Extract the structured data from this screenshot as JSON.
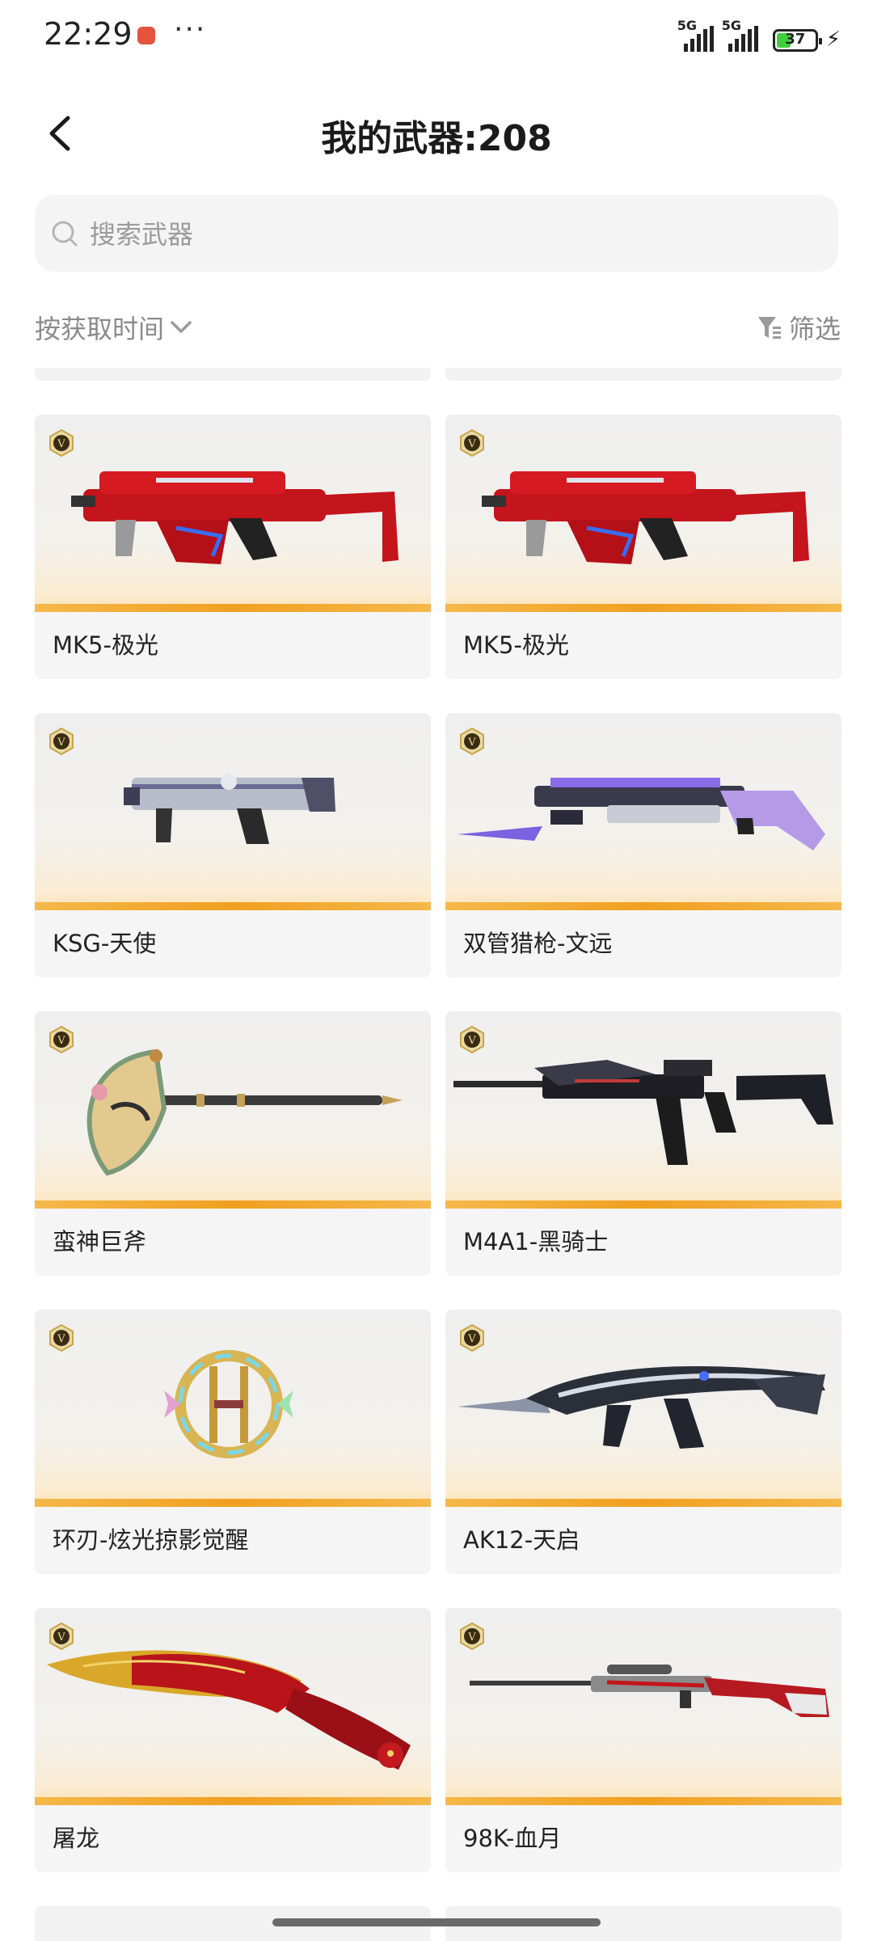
{
  "status_bar": {
    "time": "22:29",
    "more": "···",
    "signal1_label": "5G",
    "signal2_label": "5G",
    "battery": "37",
    "battery_level": 0.37
  },
  "header": {
    "title": "我的武器:208",
    "back_icon": "back-arrow-icon"
  },
  "search": {
    "placeholder": "搜索武器",
    "value": ""
  },
  "toolbar": {
    "sort_label": "按获取时间",
    "filter_label": "筛选"
  },
  "colors": {
    "accent_stripe": "#f0a020",
    "badge": "#c7a54a"
  },
  "weapons": [
    {
      "title": "MK5-极光",
      "icon": "smg-red-icon"
    },
    {
      "title": "MK5-极光",
      "icon": "smg-red-icon"
    },
    {
      "title": "KSG-天使",
      "icon": "shotgun-silver-icon"
    },
    {
      "title": "双管猎枪-文远",
      "icon": "shotgun-purple-icon"
    },
    {
      "title": "蛮神巨斧",
      "icon": "axe-icon"
    },
    {
      "title": "M4A1-黑骑士",
      "icon": "rifle-black-icon"
    },
    {
      "title": "环刃-炫光掠影觉醒",
      "icon": "ring-blade-icon"
    },
    {
      "title": "AK12-天启",
      "icon": "rifle-chrome-icon"
    },
    {
      "title": "屠龙",
      "icon": "dragon-blade-icon"
    },
    {
      "title": "98K-血月",
      "icon": "sniper-red-icon"
    }
  ]
}
